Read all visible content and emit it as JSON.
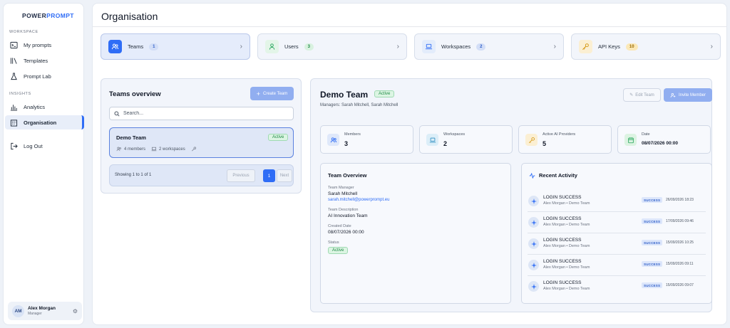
{
  "brand": {
    "part1": "POWER",
    "part2": "PROMPT"
  },
  "sidebar": {
    "section_workspace": "WORKSPACE",
    "section_insights": "INSIGHTS",
    "items": [
      {
        "label": "My prompts",
        "icon": "terminal-icon"
      },
      {
        "label": "Templates",
        "icon": "books-icon"
      },
      {
        "label": "Prompt Lab",
        "icon": "flask-icon"
      },
      {
        "label": "Analytics",
        "icon": "bar-chart-icon"
      },
      {
        "label": "Organisation",
        "icon": "building-icon"
      },
      {
        "label": "Log Out",
        "icon": "logout-icon"
      }
    ],
    "user": {
      "initials": "AM",
      "name": "Alex Morgan",
      "role": "Manager"
    }
  },
  "header": {
    "title": "Organisation"
  },
  "tabs": [
    {
      "label": "Teams",
      "count": "1",
      "icon": "users-icon",
      "color": "#2f6df6"
    },
    {
      "label": "Users",
      "count": "3",
      "icon": "user-icon",
      "color": "#22a55a"
    },
    {
      "label": "Workspaces",
      "count": "2",
      "icon": "laptop-icon",
      "color": "#2f6df6"
    },
    {
      "label": "API Keys",
      "count": "10",
      "icon": "key-icon",
      "color": "#d4960f"
    }
  ],
  "overview": {
    "title": "Teams overview",
    "create_label": "Create Team",
    "search_placeholder": "Search...",
    "team": {
      "name": "Demo Team",
      "status": "Active",
      "members": "4 members",
      "workspaces": "2 workspaces"
    },
    "pagination": {
      "info": "Showing 1 to 1 of 1",
      "prev": "Previous",
      "page": "1",
      "next": "Next"
    }
  },
  "detail": {
    "title": "Demo Team",
    "status": "Active",
    "managers": "Managers: Sarah Mitchell, Sarah Mitchell",
    "edit_label": "Edit Team",
    "invite_label": "Invite Member",
    "kpis": [
      {
        "label": "Members",
        "value": "3"
      },
      {
        "label": "Workspaces",
        "value": "2"
      },
      {
        "label": "Active AI Providers",
        "value": "5"
      },
      {
        "label": "Date",
        "value": "08/07/2026 00:00"
      }
    ],
    "team_overview": {
      "title": "Team Overview",
      "manager_label": "Team Manager",
      "manager_name": "Sarah Mitchell",
      "manager_email": "sarah.mitchell@powerprompt.eu",
      "description_label": "Team Description",
      "description": "AI Innovation Team",
      "created_label": "Created Date",
      "created": "08/07/2026 00:00",
      "status_label": "Status",
      "status": "Active"
    },
    "activity": {
      "title": "Recent Activity",
      "items": [
        {
          "title": "LOGIN SUCCESS",
          "sub": "Alex Morgan • Demo Team",
          "badge": "SUCCESS",
          "time": "26/09/2026 18:23"
        },
        {
          "title": "LOGIN SUCCESS",
          "sub": "Alex Morgan • Demo Team",
          "badge": "SUCCESS",
          "time": "17/09/2026 09:46"
        },
        {
          "title": "LOGIN SUCCESS",
          "sub": "Alex Morgan • Demo Team",
          "badge": "SUCCESS",
          "time": "15/09/2026 10:25"
        },
        {
          "title": "LOGIN SUCCESS",
          "sub": "Alex Morgan • Demo Team",
          "badge": "SUCCESS",
          "time": "15/09/2026 09:11"
        },
        {
          "title": "LOGIN SUCCESS",
          "sub": "Alex Morgan • Demo Team",
          "badge": "SUCCESS",
          "time": "15/09/2026 09:07"
        }
      ]
    }
  }
}
